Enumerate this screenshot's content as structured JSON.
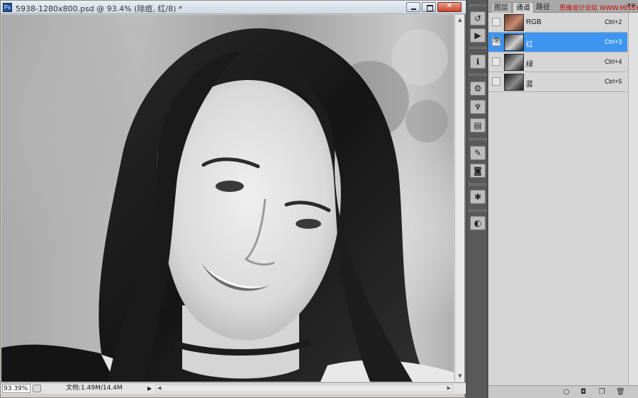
{
  "app": {
    "logo_text": "Ps"
  },
  "document": {
    "title": "5938-1280x800.psd @ 93.4% (除痘, 红/8) *",
    "image_description_hidden": ""
  },
  "status": {
    "zoom": "93.39%",
    "doc_info": "文档:1.49M/14.4M"
  },
  "dock": {
    "icons": [
      "history-icon",
      "actions-icon",
      "info-icon",
      "adjustments-icon",
      "clone-source-icon",
      "tool-presets-icon",
      "brush-presets-icon",
      "masks-icon",
      "color-palette-icon",
      "navigator-icon"
    ]
  },
  "panel": {
    "tabs": [
      {
        "label": "图层"
      },
      {
        "label": "通道"
      },
      {
        "label": "路径"
      }
    ],
    "watermark": "思缘设计论坛 WWW.MISSYUAN.COM",
    "channels": [
      {
        "name": "RGB",
        "shortcut": "Ctrl+2",
        "active": false,
        "visible": false
      },
      {
        "name": "红",
        "shortcut": "Ctrl+3",
        "active": true,
        "visible": true
      },
      {
        "name": "绿",
        "shortcut": "Ctrl+4",
        "active": false,
        "visible": false
      },
      {
        "name": "蓝",
        "shortcut": "Ctrl+5",
        "active": false,
        "visible": false
      }
    ]
  },
  "colors": {
    "selection": "#3d95f0",
    "panel_bg": "#d6d6d6",
    "dock_bg": "#595959"
  }
}
